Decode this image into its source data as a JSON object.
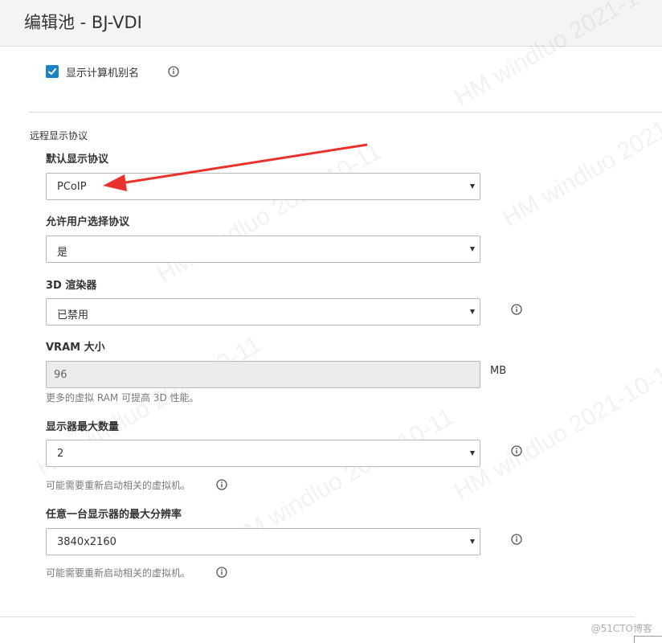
{
  "header": {
    "title": "编辑池 - BJ-VDI"
  },
  "alias": {
    "checkbox_label": "显示计算机别名",
    "checked": true
  },
  "section": {
    "title": "远程显示协议"
  },
  "fields": {
    "protocol": {
      "label": "默认显示协议",
      "value": "PCoIP"
    },
    "allow_choose": {
      "label": "允许用户选择协议",
      "value": "是"
    },
    "renderer3d": {
      "label": "3D 渲染器",
      "value": "已禁用"
    },
    "vram": {
      "label": "VRAM 大小",
      "value": "96",
      "unit": "MB",
      "hint": "更多的虚拟 RAM 可提高 3D 性能。"
    },
    "max_monitors": {
      "label": "显示器最大数量",
      "value": "2",
      "hint": "可能需要重新启动相关的虚拟机。"
    },
    "max_resolution": {
      "label": "任意一台显示器的最大分辨率",
      "value": "3840x2160",
      "hint": "可能需要重新启动相关的虚拟机。"
    }
  },
  "watermark": {
    "text": "HM windluo 2021-10-11"
  },
  "footer": {
    "source_mark": "@51CTO博客"
  },
  "colors": {
    "accent": "#1a82c4",
    "arrow": "#e8322b"
  },
  "icons": {
    "info": "info-icon",
    "check": "check-icon",
    "dropdown": "chevron-down-icon"
  }
}
